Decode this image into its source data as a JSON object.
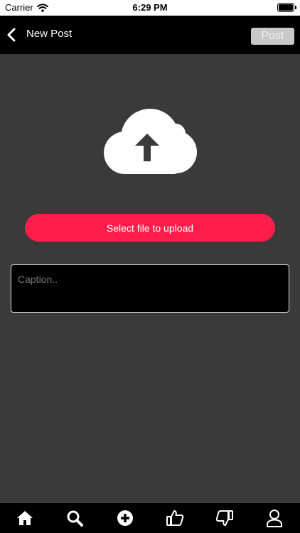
{
  "status_bar": {
    "carrier": "Carrier",
    "time": "6:29 PM",
    "icons": [
      "wifi-icon",
      "battery-icon"
    ]
  },
  "nav": {
    "back_icon": "chevron-left-icon",
    "title": "New Post",
    "post_label": "Post"
  },
  "upload": {
    "icon": "cloud-upload-icon",
    "select_label": "Select file to upload"
  },
  "caption": {
    "placeholder": "Caption..",
    "value": ""
  },
  "tab_bar": {
    "tabs": [
      "home-icon",
      "search-icon",
      "add-circle-icon",
      "thumbs-up-icon",
      "thumbs-down-icon",
      "profile-icon"
    ]
  },
  "colors": {
    "background": "#3a3a3a",
    "bar": "#000000",
    "accent": "#ff1e4b",
    "post_button": "#c8c8c8"
  }
}
